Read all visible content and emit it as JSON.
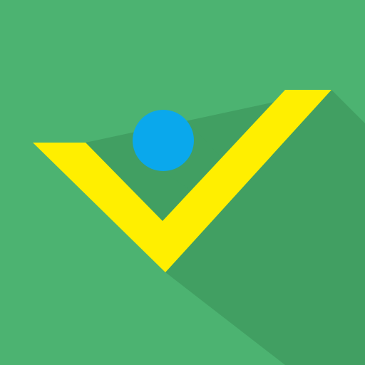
{
  "icon": {
    "name": "app-logo",
    "parts": [
      "checkmark-icon",
      "dot-icon",
      "long-shadow"
    ]
  },
  "colors": {
    "background": "#4cb371",
    "shadow": "#419f62",
    "checkmark": "#ffef00",
    "dot": "#0aa8ec"
  }
}
